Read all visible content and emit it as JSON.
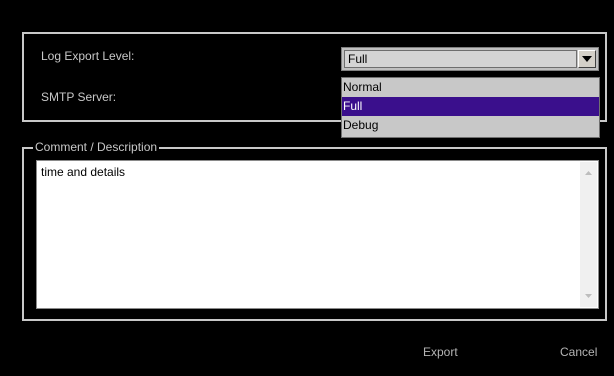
{
  "settings": {
    "log_export_level_label": "Log Export Level:",
    "smtp_server_label": "SMTP Server:",
    "log_export_level_value": "Full",
    "log_export_level_options": [
      "Normal",
      "Full",
      "Debug"
    ],
    "log_export_level_selected_index": 1
  },
  "comment": {
    "legend": "Comment / Description",
    "value": "time and details"
  },
  "buttons": {
    "export_label": "Export",
    "cancel_label": "Cancel"
  },
  "colors": {
    "background": "#000000",
    "highlight": "#3a0f8c",
    "text": "#c8c8c8"
  },
  "icons": {
    "combo_arrow": "chevron-down-icon",
    "scroll_up": "scroll-up-icon",
    "scroll_down": "scroll-down-icon"
  }
}
